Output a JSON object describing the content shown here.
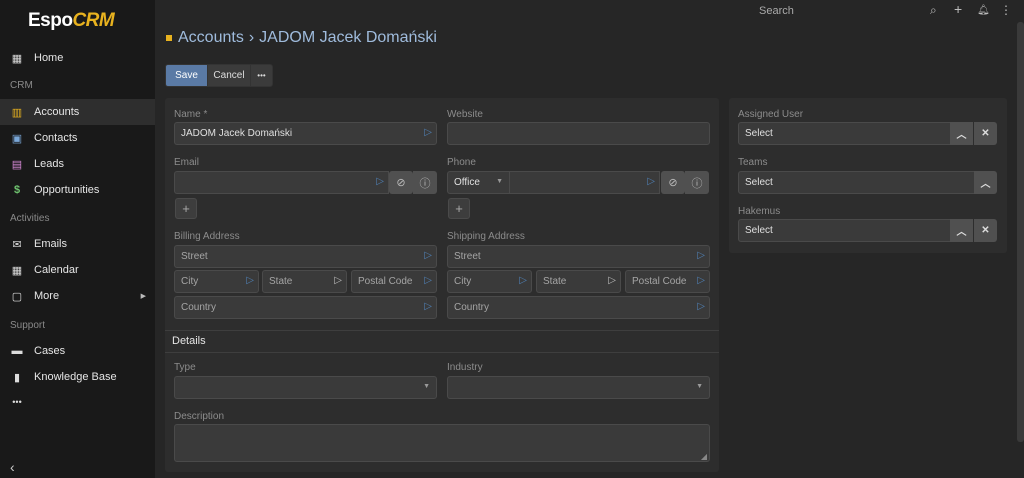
{
  "app": {
    "logo_main": "Espo",
    "logo_accent": "CRM"
  },
  "sidebar": {
    "home": "Home",
    "sec_crm": "CRM",
    "accounts": "Accounts",
    "contacts": "Contacts",
    "leads": "Leads",
    "opportunities": "Opportunities",
    "sec_activities": "Activities",
    "emails": "Emails",
    "calendar": "Calendar",
    "more": "More",
    "sec_support": "Support",
    "cases": "Cases",
    "knowledge_base": "Knowledge Base"
  },
  "topbar": {
    "search_placeholder": "Search"
  },
  "breadcrumb": {
    "parent": "Accounts",
    "separator": "›",
    "current": "JADOM Jacek Domański"
  },
  "toolbar": {
    "save": "Save",
    "cancel": "Cancel",
    "more": "•••"
  },
  "form": {
    "name_label": "Name *",
    "name_value": "JADOM Jacek Domański",
    "website_label": "Website",
    "website_value": "",
    "email_label": "Email",
    "email_value": "",
    "phone_label": "Phone",
    "phone_type": "Office",
    "phone_value": "",
    "billing_label": "Billing Address",
    "shipping_label": "Shipping Address",
    "street_ph": "Street",
    "city_ph": "City",
    "state_ph": "State",
    "postal_ph": "Postal Code",
    "country_ph": "Country",
    "details_heading": "Details",
    "type_label": "Type",
    "industry_label": "Industry",
    "description_label": "Description"
  },
  "side_panel": {
    "assigned_label": "Assigned User",
    "select_ph": "Select",
    "teams_label": "Teams",
    "hakemus_label": "Hakemus"
  }
}
